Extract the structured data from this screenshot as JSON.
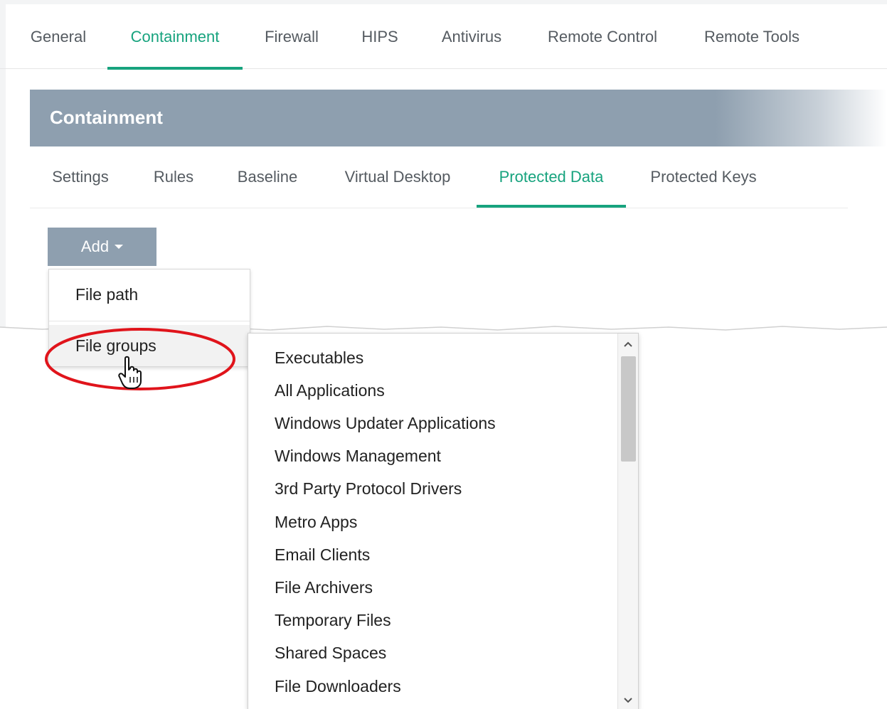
{
  "top_tabs": [
    {
      "label": "General",
      "active": false
    },
    {
      "label": "Containment",
      "active": true
    },
    {
      "label": "Firewall",
      "active": false
    },
    {
      "label": "HIPS",
      "active": false
    },
    {
      "label": "Antivirus",
      "active": false
    },
    {
      "label": "Remote Control",
      "active": false
    },
    {
      "label": "Remote Tools",
      "active": false
    }
  ],
  "section": {
    "title": "Containment"
  },
  "sub_tabs": [
    {
      "label": "Settings",
      "active": false
    },
    {
      "label": "Rules",
      "active": false
    },
    {
      "label": "Baseline",
      "active": false
    },
    {
      "label": "Virtual Desktop",
      "active": false
    },
    {
      "label": "Protected Data",
      "active": true
    },
    {
      "label": "Protected Keys",
      "active": false
    }
  ],
  "add_button": {
    "label": "Add",
    "icon": "caret-down-icon"
  },
  "add_menu": {
    "items": [
      {
        "label": "File path"
      },
      {
        "label": "File groups",
        "highlighted": true
      }
    ]
  },
  "submenu": {
    "items": [
      "Executables",
      "All Applications",
      "Windows Updater Applications",
      "Windows Management",
      "3rd Party Protocol Drivers",
      "Metro Apps",
      "Email Clients",
      "File Archivers",
      "Temporary Files",
      "Shared Spaces",
      "File Downloaders"
    ],
    "scroll_up_icon": "chevron-up-icon",
    "scroll_down_icon": "chevron-down-icon"
  },
  "colors": {
    "accent": "#17a37e",
    "header_bg": "#8e9faf",
    "annotation": "#e0141b"
  }
}
